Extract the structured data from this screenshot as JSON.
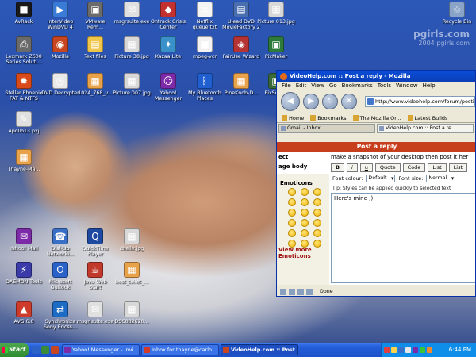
{
  "desktop": {
    "icons": [
      {
        "label": "AvRack",
        "glyph": "■",
        "color": "#1a1a1a"
      },
      {
        "label": "InterVideo\nWinDVD 4",
        "glyph": "▶",
        "color": "#3a7bd5"
      },
      {
        "label": "VMware\nRem...",
        "glyph": "▣",
        "color": "#6b6b6b"
      },
      {
        "label": "msgrsuite.exe",
        "glyph": "✉",
        "color": "#e0e0e0"
      },
      {
        "label": "Ontrack Crisis\nCenter",
        "glyph": "◆",
        "color": "#c23030"
      },
      {
        "label": "Netflix\nqueue.txt",
        "glyph": "≡",
        "color": "#f4f4f4"
      },
      {
        "label": "Ulead DVD\nMovieFactory 2",
        "glyph": "▤",
        "color": "#4a6fb0"
      },
      {
        "label": "Picture 013.jpg",
        "glyph": "▦",
        "color": "#d8d8d8"
      },
      {
        "label": "Recycle Bin",
        "glyph": "♲",
        "color": "#8aa4c8"
      },
      {
        "label": "Lexmark Z600\nSeries Soluti...",
        "glyph": "⎙",
        "color": "#6a6a6a"
      },
      {
        "label": "Mozilla",
        "glyph": "◉",
        "color": "#c8461f"
      },
      {
        "label": "Text files",
        "glyph": "▤",
        "color": "#f0c64a"
      },
      {
        "label": "Picture 38.jpg",
        "glyph": "▦",
        "color": "#d8d8d8"
      },
      {
        "label": "Kazaa Lite",
        "glyph": "✦",
        "color": "#3a90c9"
      },
      {
        "label": "mpeg-vcr",
        "glyph": "■",
        "color": "#f2f2f2"
      },
      {
        "label": "FairUse Wizard",
        "glyph": "◈",
        "color": "#b53333"
      },
      {
        "label": "PixMaker",
        "glyph": "▣",
        "color": "#2d7a3a"
      },
      {
        "label": "Stellar Phoenix\nFAT & NTFS",
        "glyph": "✹",
        "color": "#d94a1a"
      },
      {
        "label": "DVD Decrypter",
        "glyph": "◎",
        "color": "#e8e8e8"
      },
      {
        "label": "1024_768_v...",
        "glyph": "▦",
        "color": "#e8a24a"
      },
      {
        "label": "Picture 007.jpg",
        "glyph": "▦",
        "color": "#d8d8d8"
      },
      {
        "label": "Yahoo!\nMessenger",
        "glyph": "☺",
        "color": "#7c2aa8"
      },
      {
        "label": "My Bluetooth\nPlaces",
        "glyph": "ᛒ",
        "color": "#1f5fd0"
      },
      {
        "label": "PineKnob-D...",
        "glyph": "▦",
        "color": "#e8a24a"
      },
      {
        "label": "PixScre...",
        "glyph": "▣",
        "color": "#3a6a3a"
      },
      {
        "label": "Apollo13.pxj",
        "glyph": "✎",
        "color": "#e0e0e0"
      },
      {
        "label": "Thayne-Ma...",
        "glyph": "▦",
        "color": "#e8a24a"
      },
      {
        "label": "Yahoo! Mail",
        "glyph": "✉",
        "color": "#7c2aa8"
      },
      {
        "label": "Dial-Up\nNetworki...",
        "glyph": "☎",
        "color": "#3a6fc7"
      },
      {
        "label": "QuickTime\nPlayer",
        "glyph": "Q",
        "color": "#1d4aa0"
      },
      {
        "label": "chelle.jpg",
        "glyph": "▦",
        "color": "#d8d8d8"
      },
      {
        "label": "DAEMON Tools",
        "glyph": "⚡",
        "color": "#3a3aa8"
      },
      {
        "label": "Microsoft\nOutlook",
        "glyph": "O",
        "color": "#2a62c8"
      },
      {
        "label": "Java Web\nStart",
        "glyph": "☕",
        "color": "#c0392b"
      },
      {
        "label": "best_toilet_...",
        "glyph": "▦",
        "color": "#e8a24a"
      },
      {
        "label": "AVG 6.0",
        "glyph": "▲",
        "color": "#cf3b2a"
      },
      {
        "label": "Synchronize\nSony Ericss...",
        "glyph": "⇄",
        "color": "#1c6bc4"
      },
      {
        "label": "msgrlsuite.exe",
        "glyph": "✉",
        "color": "#e0e0e0"
      },
      {
        "label": "DSC082620...",
        "glyph": "▦",
        "color": "#d8d8d8"
      }
    ],
    "watermark": {
      "line1": "pgirls.com",
      "line2": "2004 pgirls.com"
    }
  },
  "browser": {
    "title": "VideoHelp.com :: Post a reply - Mozilla",
    "menu": [
      "File",
      "Edit",
      "View",
      "Go",
      "Bookmarks",
      "Tools",
      "Window",
      "Help"
    ],
    "url": "http://www.videohelp.com/forum/posting",
    "bookmarks": [
      "Home",
      "Bookmarks",
      "The Mozilla Or...",
      "Latest Builds"
    ],
    "tabs": [
      "Gmail - Inbox",
      "VideoHelp.com :: Post a re"
    ],
    "page": {
      "header": "Post a reply",
      "subject_label": "ect",
      "subject_value": "make a snapshot of your desktop then post it her",
      "message_label": "age body",
      "emoticons_label": "Emoticons",
      "view_more": "View more\nEmoticons",
      "format_buttons": [
        "B",
        "i",
        "u",
        "Quote",
        "Code",
        "List",
        "List"
      ],
      "font_colour_label": "Font colour:",
      "font_colour_value": "Default",
      "font_size_label": "Font size:",
      "font_size_value": "Normal",
      "tip": "Tip: Styles can be applied quickly to selected text",
      "message_text": "Here's mine ;)"
    },
    "status": "Done"
  },
  "taskbar": {
    "start_label": "Start",
    "tasks": [
      {
        "label": "Yahoo! Messenger - Invi...",
        "color": "#7c2aa8",
        "active": false
      },
      {
        "label": "Inbox for thayne@carlo...",
        "color": "#d03a2a",
        "active": false
      },
      {
        "label": "VideoHelp.com :: Post ...",
        "color": "#c8461f",
        "active": true
      }
    ],
    "clock": "6:44 PM"
  },
  "colors": {
    "post_header": "#c73e1d",
    "taskbar": "#245edb",
    "titlebar": "#0a4ed8"
  }
}
